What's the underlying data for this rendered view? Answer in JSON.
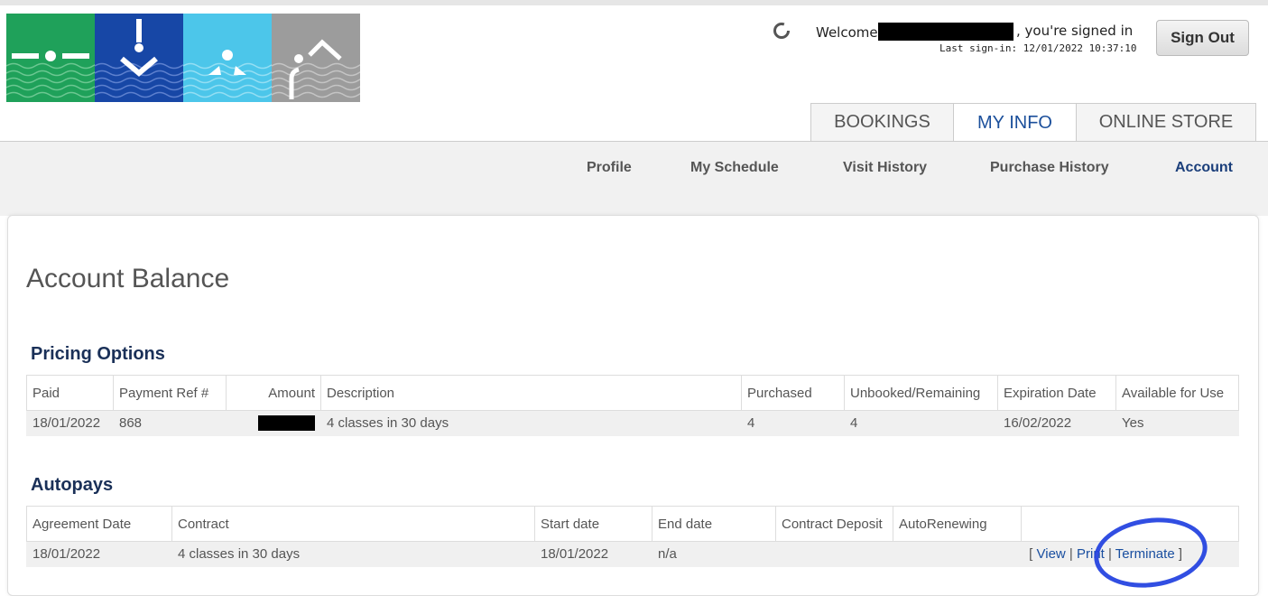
{
  "header": {
    "welcome_prefix": "Welcome",
    "welcome_suffix": ", you're signed in",
    "last_sign_in": "Last sign-in: 12/01/2022 10:37:10",
    "sign_out_label": "Sign Out",
    "icons": [
      "logo-swim-icon",
      "logo-dive-icon",
      "logo-float-icon",
      "logo-stroke-icon",
      "spinner-icon"
    ]
  },
  "main_tabs": [
    {
      "label": "BOOKINGS"
    },
    {
      "label": "MY INFO"
    },
    {
      "label": "ONLINE STORE"
    }
  ],
  "sub_nav": [
    {
      "label": "Profile"
    },
    {
      "label": "My Schedule"
    },
    {
      "label": "Visit History"
    },
    {
      "label": "Purchase History"
    },
    {
      "label": "Account"
    }
  ],
  "page": {
    "title": "Account Balance"
  },
  "pricing_options": {
    "title": "Pricing Options",
    "headers": [
      "Paid",
      "Payment Ref #",
      "Amount",
      "Description",
      "Purchased",
      "Unbooked/Remaining",
      "Expiration Date",
      "Available for Use"
    ],
    "rows": [
      {
        "paid": "18/01/2022",
        "ref": "868",
        "description": "4 classes in 30 days",
        "purchased": "4",
        "remaining": "4",
        "expiration": "16/02/2022",
        "available": "Yes"
      }
    ]
  },
  "autopays": {
    "title": "Autopays",
    "headers": [
      "Agreement Date",
      "Contract",
      "Start date",
      "End date",
      "Contract Deposit",
      "AutoRenewing",
      ""
    ],
    "rows": [
      {
        "agreement_date": "18/01/2022",
        "contract": "4 classes in 30 days",
        "start_date": "18/01/2022",
        "end_date": "n/a",
        "deposit": "",
        "auto_renewing": "",
        "actions": {
          "open": "[ ",
          "view": "View",
          "sep1": " | ",
          "print": "Print",
          "sep2": " | ",
          "terminate": "Terminate",
          "close": " ]"
        }
      }
    ]
  },
  "colors": {
    "logo_green": "#1fa15a",
    "logo_blue": "#1747a6",
    "logo_cyan": "#4cc6ea",
    "logo_grey": "#9c9c9c",
    "nav_active": "#1a3e7a",
    "section_title": "#1a3058",
    "link": "#1a4fa0",
    "annotation": "#1f3fe0"
  }
}
